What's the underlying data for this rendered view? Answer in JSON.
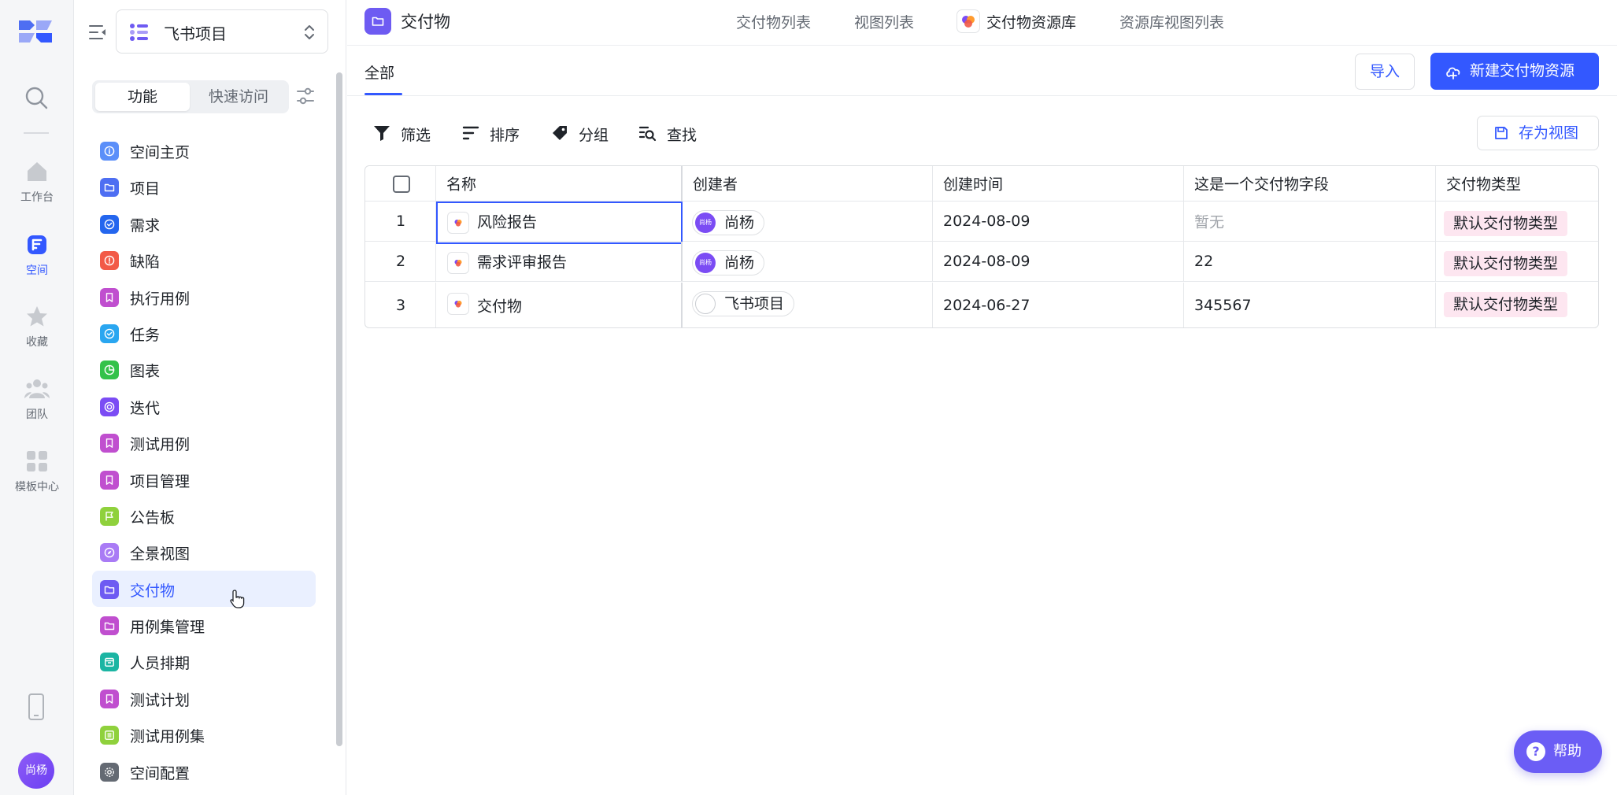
{
  "rail": {
    "items": [
      {
        "label": "工作台"
      },
      {
        "label": "空间"
      },
      {
        "label": "收藏"
      },
      {
        "label": "团队"
      },
      {
        "label": "模板中心"
      }
    ],
    "avatar_text": "尚杨",
    "active_color": "#3358ff"
  },
  "sidebar": {
    "project_name": "飞书项目",
    "segments": [
      "功能",
      "快速访问"
    ],
    "nav": [
      {
        "label": "空间主页",
        "color": "#5b8ff9",
        "icon": "info-icon"
      },
      {
        "label": "项目",
        "color": "#4e6ef2",
        "icon": "folder-icon"
      },
      {
        "label": "需求",
        "color": "#2466ee",
        "icon": "check-circle-icon"
      },
      {
        "label": "缺陷",
        "color": "#f25a47",
        "icon": "alert-icon"
      },
      {
        "label": "执行用例",
        "color": "#c04fcf",
        "icon": "bookmark-icon"
      },
      {
        "label": "任务",
        "color": "#2aa6f0",
        "icon": "check-circle-icon"
      },
      {
        "label": "图表",
        "color": "#34c24a",
        "icon": "pie-icon"
      },
      {
        "label": "迭代",
        "color": "#7b4cf4",
        "icon": "cycle-icon"
      },
      {
        "label": "测试用例",
        "color": "#c04fcf",
        "icon": "bookmark-icon"
      },
      {
        "label": "项目管理",
        "color": "#c04fcf",
        "icon": "bookmark-icon"
      },
      {
        "label": "公告板",
        "color": "#8fd13c",
        "icon": "flag-icon"
      },
      {
        "label": "全景视图",
        "color": "#a97bf5",
        "icon": "compass-icon"
      },
      {
        "label": "交付物",
        "color": "#6e5bf2",
        "icon": "folder-icon"
      },
      {
        "label": "用例集管理",
        "color": "#c04fcf",
        "icon": "folder-icon"
      },
      {
        "label": "人员排期",
        "color": "#1bb5a3",
        "icon": "calendar-icon"
      },
      {
        "label": "测试计划",
        "color": "#c04fcf",
        "icon": "bookmark-icon"
      },
      {
        "label": "测试用例集",
        "color": "#8fd13c",
        "icon": "list-icon"
      },
      {
        "label": "空间配置",
        "color": "#646a73",
        "icon": "gear-icon"
      }
    ],
    "active_index": 12
  },
  "header": {
    "title": "交付物",
    "tabs": [
      "交付物列表",
      "视图列表",
      "交付物资源库",
      "资源库视图列表"
    ],
    "active_tab": 2
  },
  "subheader": {
    "tab": "全部",
    "import_label": "导入",
    "new_label": "新建交付物资源"
  },
  "toolbar": {
    "filter": "筛选",
    "sort": "排序",
    "group": "分组",
    "find": "查找",
    "save_view": "存为视图"
  },
  "table": {
    "columns": [
      "名称",
      "创建者",
      "创建时间",
      "这是一个交付物字段",
      "交付物类型"
    ],
    "rows": [
      {
        "index": "1",
        "name": "风险报告",
        "creator": "尚杨",
        "creator_avatar": "尚杨",
        "created": "2024-08-09",
        "field": "暂无",
        "field_empty": true,
        "type": "默认交付物类型"
      },
      {
        "index": "2",
        "name": "需求评审报告",
        "creator": "尚杨",
        "creator_avatar": "尚杨",
        "created": "2024-08-09",
        "field": "22",
        "field_empty": false,
        "type": "默认交付物类型"
      },
      {
        "index": "3",
        "name": "交付物",
        "creator": "飞书项目",
        "creator_avatar": "",
        "created": "2024-06-27",
        "field": "345567",
        "field_empty": false,
        "type": "默认交付物类型"
      }
    ]
  },
  "help_label": "帮助"
}
